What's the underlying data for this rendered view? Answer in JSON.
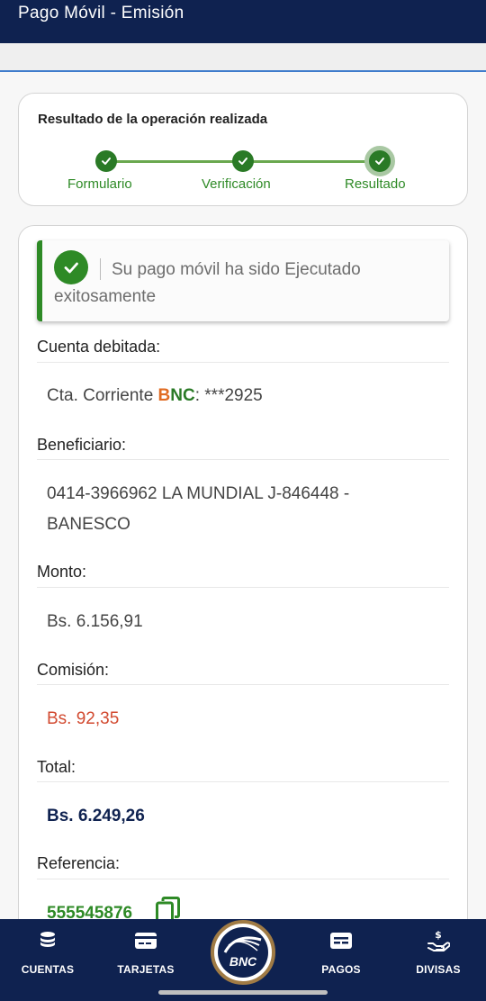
{
  "header": {
    "title": "Pago Móvil - Emisión"
  },
  "steps": {
    "title": "Resultado de la operación realizada",
    "items": [
      {
        "label": "Formulario"
      },
      {
        "label": "Verificación"
      },
      {
        "label": "Resultado"
      }
    ]
  },
  "alert": {
    "message": "Su pago móvil ha sido Ejecutado exitosamente"
  },
  "fields": {
    "account_label": "Cuenta debitada:",
    "account_prefix": "Cta. Corriente ",
    "account_bank_b": "B",
    "account_bank_nc": "NC",
    "account_suffix": ": ***2925",
    "beneficiary_label": "Beneficiario:",
    "beneficiary_line1": "0414-3966962 LA MUNDIAL J-846448 -",
    "beneficiary_line2": "BANESCO",
    "amount_label": "Monto:",
    "amount_value": "Bs. 6.156,91",
    "commission_label": "Comisión:",
    "commission_value": "Bs. 92,35",
    "total_label": "Total:",
    "total_value": "Bs. 6.249,26",
    "reference_label": "Referencia:",
    "reference_value": "555545876"
  },
  "nav": {
    "items": [
      {
        "label": "CUENTAS",
        "icon": "coins-icon"
      },
      {
        "label": "TARJETAS",
        "icon": "card-icon"
      },
      {
        "label": "PAGOS",
        "icon": "payments-icon"
      },
      {
        "label": "DIVISAS",
        "icon": "currency-hand-icon"
      }
    ],
    "logo_text": "BNC"
  },
  "colors": {
    "primary": "#0f2250",
    "success": "#2e8a26",
    "accent_orange": "#e06b22",
    "commission_red": "#d24a30"
  }
}
